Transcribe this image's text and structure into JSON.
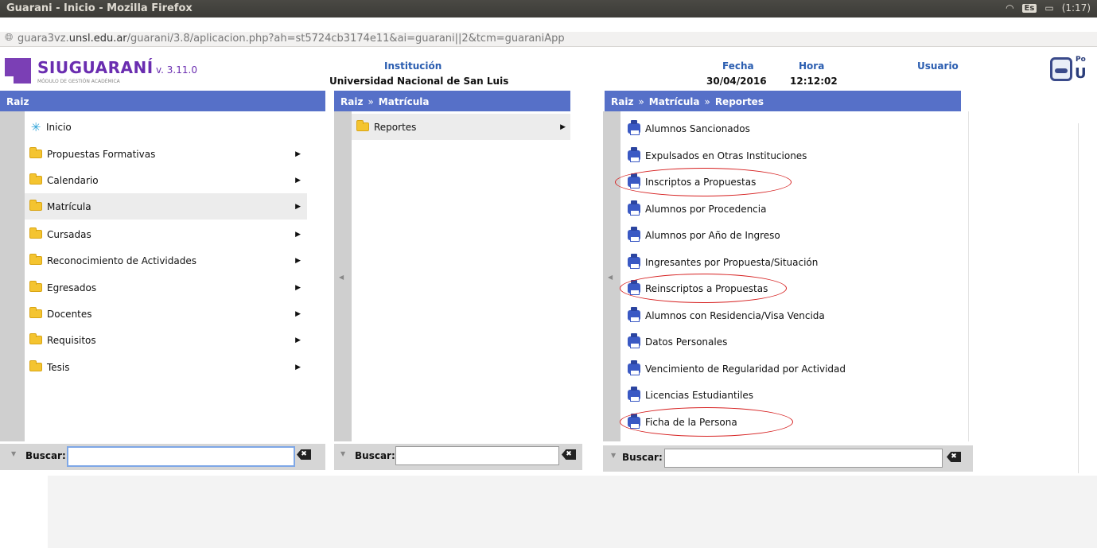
{
  "window": {
    "title": "Guarani - Inicio - Mozilla Firefox",
    "keyboard": "Es",
    "battery": "(1:17)"
  },
  "browser": {
    "url_prefix": "guara3vz.",
    "url_domain": "unsl.edu.ar",
    "url_rest": "/guarani/3.8/aplicacion.php?ah=st5724cb3174e11&ai=guarani||2&tcm=guaraniApp"
  },
  "header": {
    "brand": "SIUGUARANÍ",
    "version": "v. 3.11.0",
    "subtitle": "MÓDULO DE GESTIÓN ACADÉMICA",
    "institucion_label": "Institución",
    "institucion_value": "Universidad Nacional de San Luis",
    "fecha_label": "Fecha",
    "fecha_value": "30/04/2016",
    "hora_label": "Hora",
    "hora_value": "12:12:02",
    "usuario_label": "Usuario",
    "usuario_value": "",
    "corner_text_small": "Po",
    "corner_text_big": "U"
  },
  "panel1": {
    "breadcrumb": [
      "Raiz"
    ],
    "items": [
      {
        "label": "Inicio",
        "icon": "star-icon",
        "submenu": false
      },
      {
        "label": "Propuestas Formativas",
        "icon": "folder-icon",
        "submenu": true
      },
      {
        "label": "Calendario",
        "icon": "folder-icon",
        "submenu": true
      },
      {
        "label": "Matrícula",
        "icon": "folder-icon",
        "submenu": true,
        "active": true
      },
      {
        "label": "Cursadas",
        "icon": "folder-icon",
        "submenu": true
      },
      {
        "label": "Reconocimiento de Actividades",
        "icon": "folder-icon",
        "submenu": true
      },
      {
        "label": "Egresados",
        "icon": "folder-icon",
        "submenu": true
      },
      {
        "label": "Docentes",
        "icon": "folder-icon",
        "submenu": true
      },
      {
        "label": "Requisitos",
        "icon": "folder-icon",
        "submenu": true
      },
      {
        "label": "Tesis",
        "icon": "folder-icon",
        "submenu": true
      }
    ],
    "search_label": "Buscar:",
    "search_value": ""
  },
  "panel2": {
    "breadcrumb": [
      "Raiz",
      "Matrícula"
    ],
    "items": [
      {
        "label": "Reportes",
        "icon": "folder-icon",
        "submenu": true,
        "active": true
      }
    ],
    "search_label": "Buscar:",
    "search_value": ""
  },
  "panel3": {
    "breadcrumb": [
      "Raiz",
      "Matrícula",
      "Reportes"
    ],
    "items": [
      {
        "label": "Alumnos Sancionados",
        "circled": false
      },
      {
        "label": "Expulsados en Otras Instituciones",
        "circled": false
      },
      {
        "label": "Inscriptos a Propuestas",
        "circled": true
      },
      {
        "label": "Alumnos por Procedencia",
        "circled": false
      },
      {
        "label": "Alumnos por Año de Ingreso",
        "circled": false
      },
      {
        "label": "Ingresantes por Propuesta/Situación",
        "circled": false
      },
      {
        "label": "Reinscriptos a Propuestas",
        "circled": true
      },
      {
        "label": "Alumnos con Residencia/Visa Vencida",
        "circled": false
      },
      {
        "label": "Datos Personales",
        "circled": false
      },
      {
        "label": "Vencimiento de Regularidad por Actividad",
        "circled": false
      },
      {
        "label": "Licencias Estudiantiles",
        "circled": false
      },
      {
        "label": "Ficha de la Persona",
        "circled": true
      }
    ],
    "search_label": "Buscar:",
    "search_value": ""
  },
  "colors": {
    "panel_header": "#5670c8",
    "brand": "#6a2db0",
    "annotation": "#d62020"
  }
}
